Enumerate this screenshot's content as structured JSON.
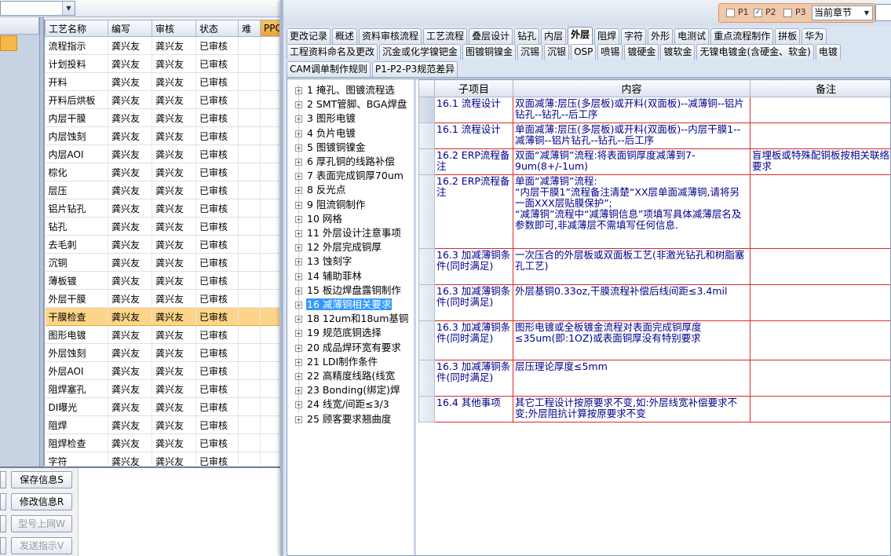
{
  "left": {
    "grid": {
      "headers": [
        "工艺名称",
        "编写",
        "审核",
        "状态",
        "难",
        "PPC"
      ],
      "rows": [
        [
          "流程指示",
          "龚兴友",
          "龚兴友",
          "已审核"
        ],
        [
          "计划投料",
          "龚兴友",
          "龚兴友",
          "已审核"
        ],
        [
          "开料",
          "龚兴友",
          "龚兴友",
          "已审核"
        ],
        [
          "开料后烘板",
          "龚兴友",
          "龚兴友",
          "已审核"
        ],
        [
          "内层干膜",
          "龚兴友",
          "龚兴友",
          "已审核"
        ],
        [
          "内层蚀刻",
          "龚兴友",
          "龚兴友",
          "已审核"
        ],
        [
          "内层AOI",
          "龚兴友",
          "龚兴友",
          "已审核"
        ],
        [
          "棕化",
          "龚兴友",
          "龚兴友",
          "已审核"
        ],
        [
          "层压",
          "龚兴友",
          "龚兴友",
          "已审核"
        ],
        [
          "铝片钻孔",
          "龚兴友",
          "龚兴友",
          "已审核"
        ],
        [
          "钻孔",
          "龚兴友",
          "龚兴友",
          "已审核"
        ],
        [
          "去毛刺",
          "龚兴友",
          "龚兴友",
          "已审核"
        ],
        [
          "沉铜",
          "龚兴友",
          "龚兴友",
          "已审核"
        ],
        [
          "薄板镀",
          "龚兴友",
          "龚兴友",
          "已审核"
        ],
        [
          "外层干膜",
          "龚兴友",
          "龚兴友",
          "已审核"
        ],
        [
          "干膜检查",
          "龚兴友",
          "龚兴友",
          "已审核"
        ],
        [
          "图形电镀",
          "龚兴友",
          "龚兴友",
          "已审核"
        ],
        [
          "外层蚀刻",
          "龚兴友",
          "龚兴友",
          "已审核"
        ],
        [
          "外层AOI",
          "龚兴友",
          "龚兴友",
          "已审核"
        ],
        [
          "阻焊塞孔",
          "龚兴友",
          "龚兴友",
          "已审核"
        ],
        [
          "DI曝光",
          "龚兴友",
          "龚兴友",
          "已审核"
        ],
        [
          "阻焊",
          "龚兴友",
          "龚兴友",
          "已审核"
        ],
        [
          "阻焊检查",
          "龚兴友",
          "龚兴友",
          "已审核"
        ],
        [
          "字符",
          "龚兴友",
          "龚兴友",
          "已审核"
        ]
      ],
      "selected_row": 15
    },
    "buttons": [
      {
        "label": "保存信息S",
        "enabled": true
      },
      {
        "label": "修改信息R",
        "enabled": true
      },
      {
        "label": "型号上网W",
        "enabled": false
      },
      {
        "label": "发送指示V",
        "enabled": false
      }
    ]
  },
  "main": {
    "filters": {
      "p1": {
        "label": "P1",
        "checked": false
      },
      "p2": {
        "label": "P2",
        "checked": true
      },
      "p3": {
        "label": "P3",
        "checked": false
      },
      "chapter_select": "当前章节"
    },
    "tabs_row1": [
      "更改记录",
      "概述",
      "资料审核流程",
      "工艺流程",
      "叠层设计",
      "钻孔",
      "内层",
      "外层",
      "阻焊",
      "字符",
      "外形",
      "电测试",
      "重点流程制作",
      "拼板",
      "华为"
    ],
    "active_tab_index": 7,
    "tabs_row2": [
      "工程资料命名及更改",
      "沉金或化学镍钯金",
      "图镀铜镍金",
      "沉锡",
      "沉银",
      "OSP",
      "喷锡",
      "镀硬金",
      "镀软金",
      "无镍电镀金(含硬金、软金)",
      "电镀"
    ],
    "tabs_row3": [
      "CAM调单制作规则",
      "P1-P2-P3规范差异"
    ],
    "tree": {
      "items": [
        "1 掩孔、图镀流程选",
        "2 SMT管脚、BGA焊盘",
        "3 图形电镀",
        "4 负片电镀",
        "5 图镀铜镍金",
        "6 厚孔铜的线路补偿",
        "7 表面完成铜厚70um",
        "8 反光点",
        "9 阻流铜制作",
        "10 网格",
        "11 外层设计注意事项",
        "12 外层完成铜厚",
        "13 蚀刻字",
        "14 辅助菲林",
        "15 板边焊盘露铜制作",
        "16 减薄铜相关要求",
        "18 12um和18um基铜",
        "19 规范底铜选择",
        "20 成品焊环宽有要求",
        "21 LDI制作条件",
        "22 高精度线路(线宽",
        "23 Bonding(绑定)焊",
        "24 线宽/间距≤3/3",
        "25 顾客要求翘曲度"
      ],
      "selected_index": 15
    },
    "detail": {
      "headers": [
        "子项目",
        "内容",
        "备注"
      ],
      "rows": [
        {
          "sub": "16.1 流程设计",
          "content": "双面减薄:层压(多层板)或开料(双面板)--减薄铜--铝片钻孔--钻孔--后工序",
          "note": ""
        },
        {
          "sub": "16.1 流程设计",
          "content": "单面减薄:层压(多层板)或开料(双面板)--内层干膜1--减薄铜--铝片钻孔--钻孔--后工序",
          "note": ""
        },
        {
          "sub": "16.2 ERP流程备注",
          "content": "双面“减薄铜”流程:将表面铜厚度减薄到7-9um(8+/-1um)",
          "note": "盲埋板或特殊配铜板按相关联络单要求"
        },
        {
          "sub": "16.2 ERP流程备注",
          "content": "单面“减薄铜”流程:\n“内层干膜1”流程备注清楚“XX层单面减薄铜,请将另一面XXX层贴膜保护”;\n“减薄铜”流程中“减薄铜信息”项填写具体减薄层名及参数即可,非减薄层不需填写任何信息.",
          "note": ""
        },
        {
          "sub": "16.3 加减薄铜条件(同时满足)",
          "content": "一次压合的外层板或双面板工艺(非激光钻孔和树脂塞孔工艺)",
          "note": ""
        },
        {
          "sub": "16.3 加减薄铜条件(同时满足)",
          "content": "外层基铜0.33oz,干膜流程补偿后线间距≤3.4mil",
          "note": ""
        },
        {
          "sub": "16.3 加减薄铜条件(同时满足)",
          "content": "图形电镀或全板镀金流程对表面完成铜厚度≤35um(即:1OZ)或表面铜厚没有特别要求",
          "note": ""
        },
        {
          "sub": "16.3 加减薄铜条件(同时满足)",
          "content": "层压理论厚度≤5mm",
          "note": ""
        },
        {
          "sub": "16.4 其他事项",
          "content": "其它工程设计按原要求不变,如:外层线宽补偿要求不变;外层阻抗计算按原要求不变",
          "note": ""
        }
      ]
    }
  }
}
